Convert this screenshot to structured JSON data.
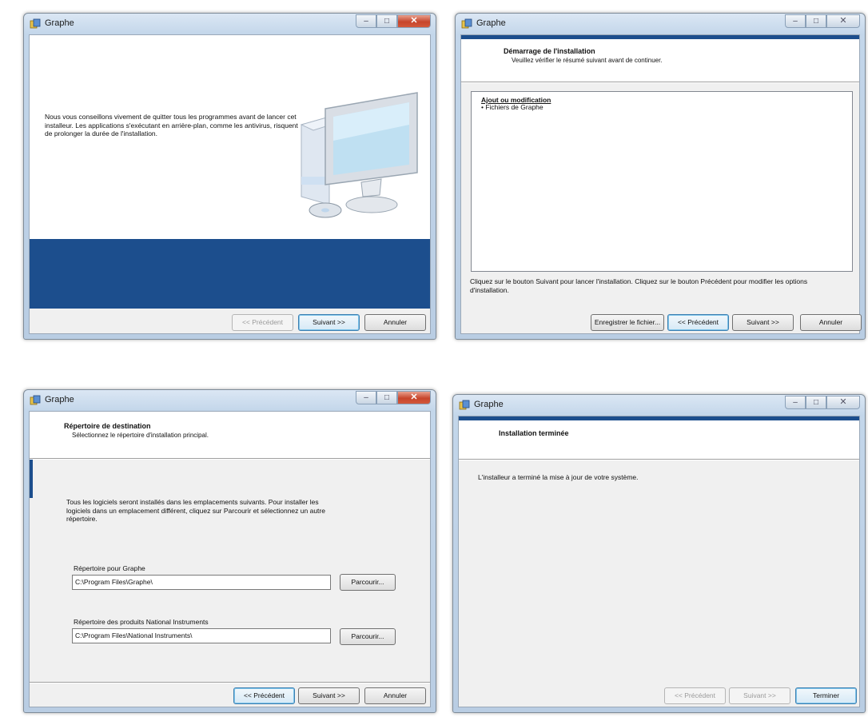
{
  "screens": [
    {
      "title": "Graphe",
      "message": "Nous vous conseillons vivement de quitter tous les programmes avant de lancer cet installeur. Les applications s'exécutant en arrière-plan, comme les antivirus, risquent de prolonger la durée de l'installation.",
      "buttons": {
        "previous": "<< Précédent",
        "next": "Suivant >>",
        "cancel": "Annuler"
      }
    },
    {
      "title": "Graphe",
      "header_title": "Démarrage de l'installation",
      "header_subtitle": "Veuillez vérifier le résumé suivant avant de continuer.",
      "summary_heading": "Ajout ou modification",
      "summary_items": [
        "• Fichiers de Graphe"
      ],
      "footer_text": "Cliquez sur le bouton Suivant pour lancer l'installation.  Cliquez sur le bouton Précédent pour modifier les options d'installation.",
      "buttons": {
        "save": "Enregistrer le fichier...",
        "previous": "<< Précédent",
        "next": "Suivant >>",
        "cancel": "Annuler"
      }
    },
    {
      "title": "Graphe",
      "header_title": "Répertoire de destination",
      "header_subtitle": "Sélectionnez le répertoire d'installation principal.",
      "intro": "Tous les logiciels seront installés dans les emplacements suivants. Pour installer les logiciels dans un emplacement différent, cliquez sur Parcourir et sélectionnez un autre répertoire.",
      "dir1_label": "Répertoire pour Graphe",
      "dir1_value": "C:\\Program Files\\Graphe\\",
      "dir2_label": "Répertoire des produits National Instruments",
      "dir2_value": "C:\\Program Files\\National Instruments\\",
      "browse": "Parcourir...",
      "buttons": {
        "previous": "<< Précédent",
        "next": "Suivant >>",
        "cancel": "Annuler"
      }
    },
    {
      "title": "Graphe",
      "header_title": "Installation terminée",
      "message": "L'installeur a terminé la mise à jour de votre système.",
      "buttons": {
        "previous": "<< Précédent",
        "next": "Suivant >>",
        "finish": "Terminer"
      }
    }
  ],
  "colors": {
    "accent": "#1c4e8d",
    "dialog_bg": "#f0f0f0"
  },
  "icons": [
    "installer-icon",
    "minimize-icon",
    "maximize-icon",
    "close-icon",
    "computer-illustration-icon"
  ]
}
